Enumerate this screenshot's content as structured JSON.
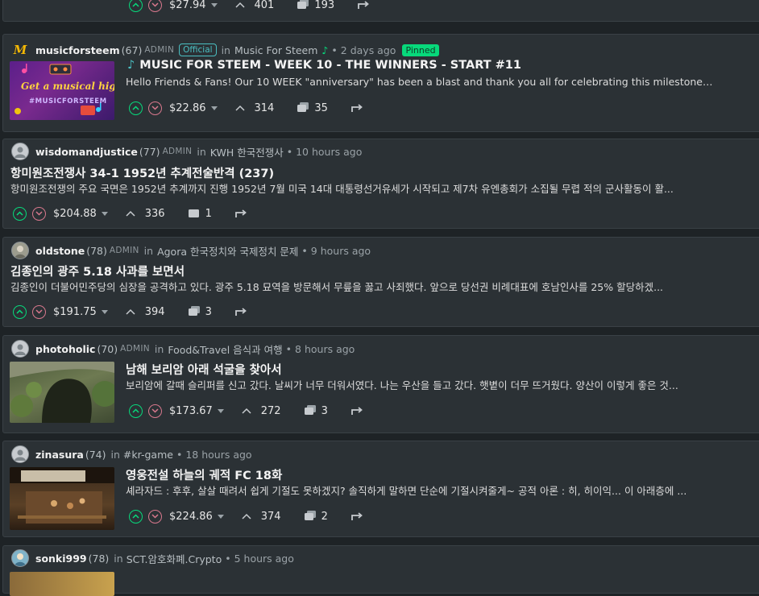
{
  "posts": [
    {
      "payout": "$27.94",
      "votes": "401",
      "comments": "193"
    },
    {
      "author": "musicforsteem",
      "rep": "(67)",
      "role": "ADMIN",
      "badge": "Official",
      "in": "in",
      "community": "Music For Steem",
      "time": "2 days ago",
      "pinned": "Pinned",
      "title": "MUSIC FOR STEEM - WEEK 10 - THE WINNERS - START #11",
      "excerpt": "Hello Friends & Fans! Our 10 WEEK \"anniversary\" has been a blast and thank you all for celebrating this milestone…",
      "payout": "$22.86",
      "votes": "314",
      "comments": "35",
      "thumb_text_1": "Get a musical high",
      "thumb_text_2": "#MUSICFORSTEEM",
      "logo": "M"
    },
    {
      "author": "wisdomandjustice",
      "rep": "(77)",
      "role": "ADMIN",
      "in": "in",
      "community": "KWH 한국전쟁사",
      "time": "10 hours ago",
      "title": "항미원조전쟁사 34-1 1952년 추계전술반격 (237)",
      "excerpt": "항미원조전쟁의 주요 국면은 1952년 추계까지 진행 1952년 7월 미국 14대 대통령선거유세가 시작되고 제7차 유엔총회가 소집될 무렵 적의 군사활동이 활...",
      "payout": "$204.88",
      "votes": "336",
      "comments": "1"
    },
    {
      "author": "oldstone",
      "rep": "(78)",
      "role": "ADMIN",
      "in": "in",
      "community": "Agora 한국정치와 국제정치 문제",
      "time": "9 hours ago",
      "title": "김종인의 광주 5.18 사과를 보면서",
      "excerpt": "김종인이 더불어민주당의 심장을 공격하고 있다. 광주 5.18 묘역을 방문해서 무릎을 꿇고 사죄했다. 앞으로 당선권 비례대표에 호남인사를 25% 할당하겠...",
      "payout": "$191.75",
      "votes": "394",
      "comments": "3"
    },
    {
      "author": "photoholic",
      "rep": "(70)",
      "role": "ADMIN",
      "in": "in",
      "community": "Food&Travel 음식과 여행",
      "time": "8 hours ago",
      "title": "남해 보리암 아래 석굴을 찾아서",
      "excerpt": "보리암에 갈때 슬리퍼를 신고 갔다. 날씨가 너무 더워서였다. 나는 우산을 들고 갔다. 햇볕이 더무 뜨거웠다. 양산이 이렇게 좋은 것...",
      "payout": "$173.67",
      "votes": "272",
      "comments": "3"
    },
    {
      "author": "zinasura",
      "rep": "(74)",
      "in": "in",
      "community": "#kr-game",
      "time": "18 hours ago",
      "title": "영웅전설 하늘의 궤적 FC 18화",
      "excerpt": "셰라자드 : 후후, 살살 때려서 쉽게 기절도 못하겠지? 솔직하게 말하면 단순에 기절시켜줄게~ 공적 아론 : 히, 히이익... 이 아래층에 ...",
      "payout": "$224.86",
      "votes": "374",
      "comments": "2"
    },
    {
      "author": "sonki999",
      "rep": "(78)",
      "in": "in",
      "community": "SCT.암호화폐.Crypto",
      "time": "5 hours ago"
    }
  ],
  "icons": {
    "upvote": "chevron-up-icon",
    "downvote": "chevron-down-icon",
    "votes": "votes-chevron-icon",
    "comments": "comments-icon",
    "reblog": "reblog-icon"
  },
  "colors": {
    "accent": "#07d97b",
    "official": "#4bbfc2",
    "downvote": "#d8788d",
    "card": "#2b3135",
    "background": "#1e2326"
  }
}
